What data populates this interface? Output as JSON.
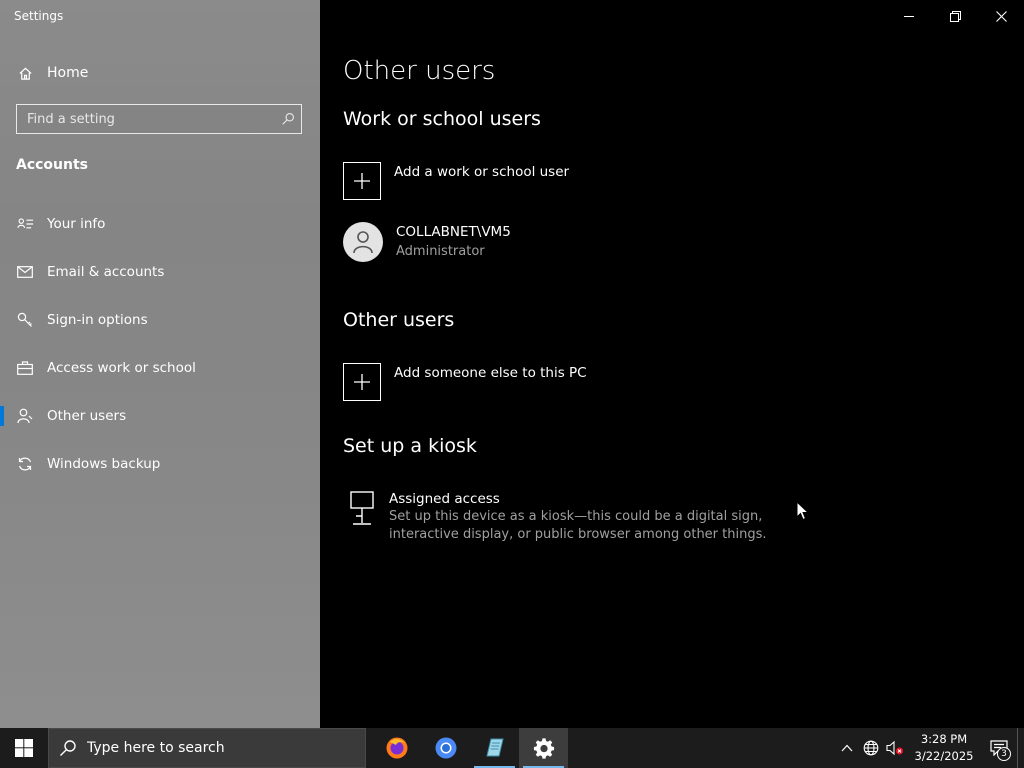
{
  "window": {
    "title": "Settings",
    "controls": {
      "minimize": "minimize",
      "restore": "restore",
      "close": "close"
    }
  },
  "sidebar": {
    "home_label": "Home",
    "search": {
      "placeholder": "Find a setting",
      "value": ""
    },
    "section_title": "Accounts",
    "items": [
      {
        "label": "Your info",
        "icon": "contact-card-icon",
        "active": false
      },
      {
        "label": "Email & accounts",
        "icon": "mail-icon",
        "active": false
      },
      {
        "label": "Sign-in options",
        "icon": "key-icon",
        "active": false
      },
      {
        "label": "Access work or school",
        "icon": "briefcase-icon",
        "active": false
      },
      {
        "label": "Other users",
        "icon": "person-icon",
        "active": true
      },
      {
        "label": "Windows backup",
        "icon": "sync-icon",
        "active": false
      }
    ]
  },
  "main": {
    "page_title": "Other users",
    "work_school": {
      "heading": "Work or school users",
      "add_label": "Add a work or school user",
      "user": {
        "name": "COLLABNET\\VM5",
        "role": "Administrator"
      }
    },
    "other_users": {
      "heading": "Other users",
      "add_label": "Add someone else to this PC"
    },
    "kiosk": {
      "heading": "Set up a kiosk",
      "title": "Assigned access",
      "desc_line1": "Set up this device as a kiosk—this could be a digital sign,",
      "desc_line2": "interactive display, or public browser among other things."
    }
  },
  "taskbar": {
    "search_placeholder": "Type here to search",
    "apps": [
      {
        "name": "firefox",
        "running": false,
        "active": false
      },
      {
        "name": "chrome",
        "running": false,
        "active": false
      },
      {
        "name": "notepad",
        "running": true,
        "active": false
      },
      {
        "name": "settings",
        "running": true,
        "active": true
      }
    ],
    "clock": {
      "time": "3:28 PM",
      "date": "3/22/2025"
    },
    "notification_count": "3"
  },
  "colors": {
    "accent": "#0078d7",
    "sidebar_bg": "#878787",
    "main_bg": "#000000",
    "taskbar_bg": "#1c1c1c",
    "secondary_text": "#a0a0a0"
  }
}
